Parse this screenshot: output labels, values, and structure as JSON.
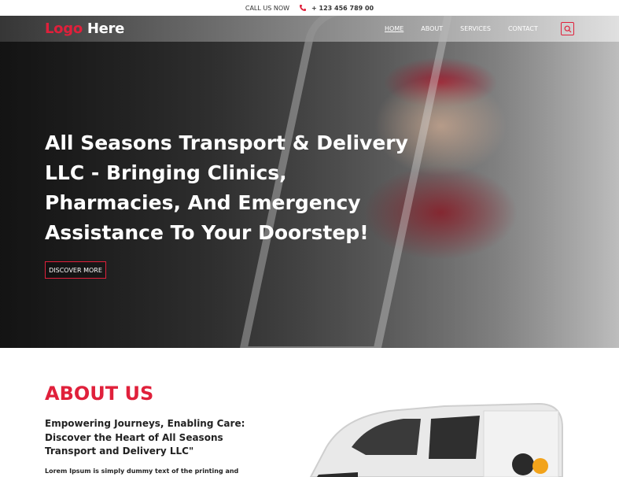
{
  "topbar": {
    "call_label": "CALL US NOW",
    "phone": "+ 123 456 789 00"
  },
  "logo": {
    "part1": "Logo",
    "part2": "Here"
  },
  "nav": {
    "items": [
      "HOME",
      "ABOUT",
      "SERVICES",
      "CONTACT"
    ],
    "active": "HOME"
  },
  "hero": {
    "title": "All Seasons Transport & Delivery LLC - Bringing Clinics, Pharmacies, And Emergency Assistance To Your Doorstep!",
    "cta_label": "DISCOVER MORE"
  },
  "about": {
    "heading": "ABOUT US",
    "subheading": "Empowering Journeys, Enabling Care: Discover the Heart of All Seasons Transport and Delivery LLC\"",
    "text": "Lorem Ipsum is simply dummy text of the printing and"
  },
  "icons": {
    "phone": "phone-icon",
    "search": "search-icon"
  },
  "colors": {
    "accent": "#e0203b",
    "white": "#ffffff",
    "dark": "#222222"
  }
}
